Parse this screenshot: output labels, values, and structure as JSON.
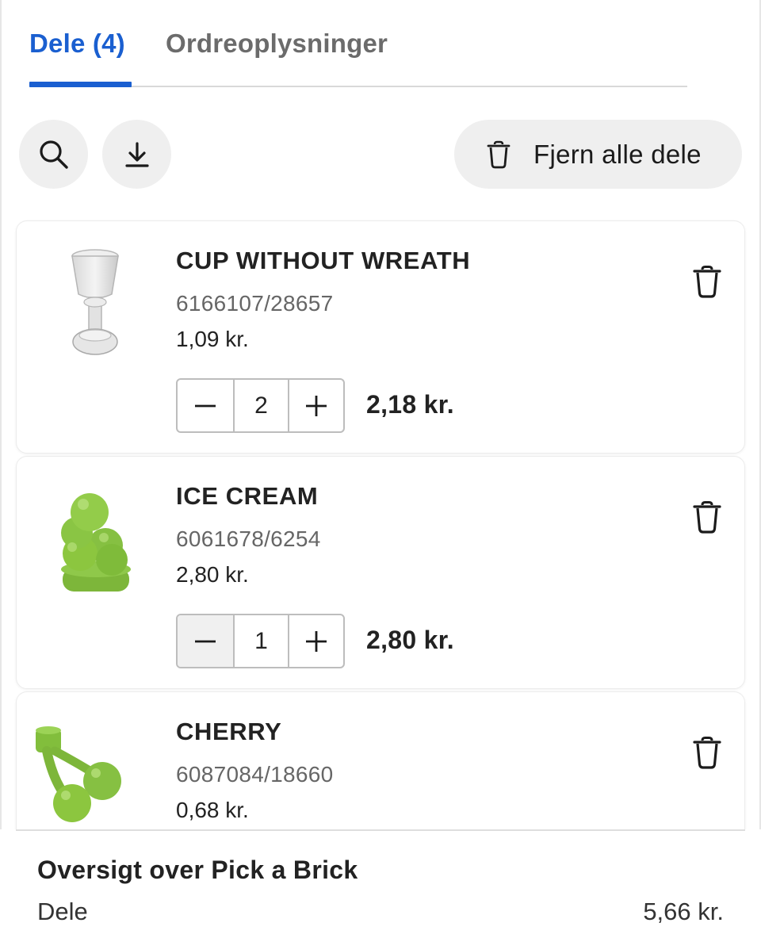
{
  "tabs": [
    {
      "label": "Dele (4)",
      "active": true
    },
    {
      "label": "Ordreoplysninger",
      "active": false
    }
  ],
  "toolbar": {
    "search_icon": "search-icon",
    "download_icon": "download-icon",
    "remove_all_label": "Fjern alle dele"
  },
  "items": [
    {
      "name": "CUP WITHOUT WREATH",
      "code": "6166107/28657",
      "unit_price": "1,09 kr.",
      "quantity": "2",
      "line_total": "2,18 kr.",
      "image": "transparent-cup"
    },
    {
      "name": "ICE CREAM",
      "code": "6061678/6254",
      "unit_price": "2,80 kr.",
      "quantity": "1",
      "line_total": "2,80 kr.",
      "image": "green-ice-cream"
    },
    {
      "name": "CHERRY",
      "code": "6087084/18660",
      "unit_price": "0,68 kr.",
      "image": "green-cherry"
    }
  ],
  "summary": {
    "title": "Oversigt over Pick a Brick",
    "parts_label": "Dele",
    "parts_value": "5,66 kr."
  },
  "colors": {
    "accent": "#1a5fd0",
    "lime_part": "#8cc63f"
  }
}
